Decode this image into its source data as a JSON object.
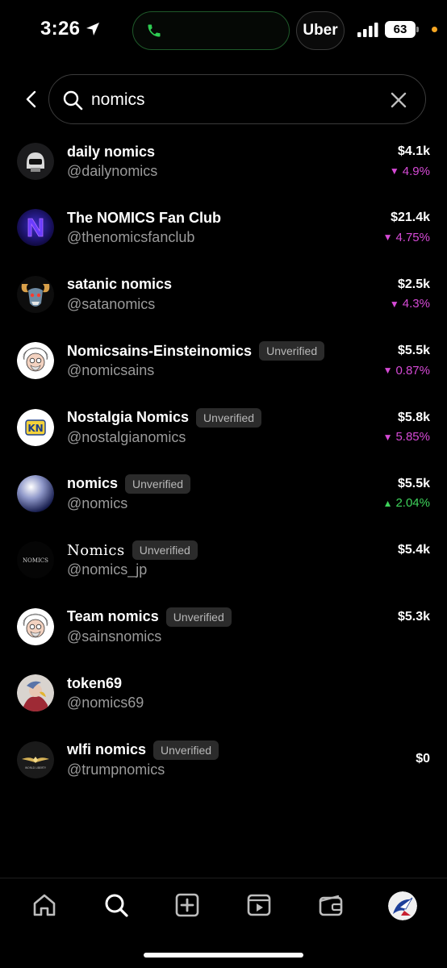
{
  "status_bar": {
    "time": "3:26",
    "uber_label": "Uber",
    "battery": "63",
    "call_color": "#2ecc52",
    "icons": [
      "location-arrow-icon",
      "phone-icon",
      "signal-icon",
      "battery-icon"
    ]
  },
  "search": {
    "query": "nomics",
    "icons": [
      "back-chevron-icon",
      "search-icon",
      "clear-x-icon"
    ]
  },
  "results": [
    {
      "name": "daily nomics",
      "handle": "@dailynomics",
      "unverified": false,
      "price": "$4.1k",
      "change": "4.9%",
      "direction": "down"
    },
    {
      "name": "The NOMICS Fan Club",
      "handle": "@thenomicsfanclub",
      "unverified": false,
      "price": "$21.4k",
      "change": "4.75%",
      "direction": "down"
    },
    {
      "name": "satanic nomics",
      "handle": "@satanomics",
      "unverified": false,
      "price": "$2.5k",
      "change": "4.3%",
      "direction": "down"
    },
    {
      "name": "Nomicsains-Einsteinomics",
      "handle": "@nomicsains",
      "unverified": true,
      "price": "$5.5k",
      "change": "0.87%",
      "direction": "down"
    },
    {
      "name": "Nostalgia Nomics",
      "handle": "@nostalgianomics",
      "unverified": true,
      "price": "$5.8k",
      "change": "5.85%",
      "direction": "down"
    },
    {
      "name": "nomics",
      "handle": "@nomics",
      "unverified": true,
      "price": "$5.5k",
      "change": "2.04%",
      "direction": "up"
    },
    {
      "name": "Nomics",
      "handle": "@nomics_jp",
      "unverified": true,
      "price": "$5.4k",
      "change": "",
      "direction": ""
    },
    {
      "name": "Team nomics",
      "handle": "@sainsnomics",
      "unverified": true,
      "price": "$5.3k",
      "change": "",
      "direction": ""
    },
    {
      "name": "token69",
      "handle": "@nomics69",
      "unverified": false,
      "price": "",
      "change": "",
      "direction": ""
    },
    {
      "name": "wlfi nomics",
      "handle": "@trumpnomics",
      "unverified": true,
      "price": "$0",
      "change": "",
      "direction": ""
    }
  ],
  "labels": {
    "unverified": "Unverified",
    "avatar_text_nomics_jp": "NOMICS",
    "avatar_text_nostalgia": "KN",
    "avatar_text_wlfi": "WORLD LIBERTY"
  },
  "colors": {
    "down": "#d64ad6",
    "up": "#3ed35b",
    "badge_bg": "#2b2b2b"
  },
  "bottom_nav": {
    "items": [
      "home-icon",
      "search-icon",
      "create-plus-icon",
      "video-play-icon",
      "wallet-icon",
      "profile-avatar"
    ],
    "active": "search-icon"
  }
}
